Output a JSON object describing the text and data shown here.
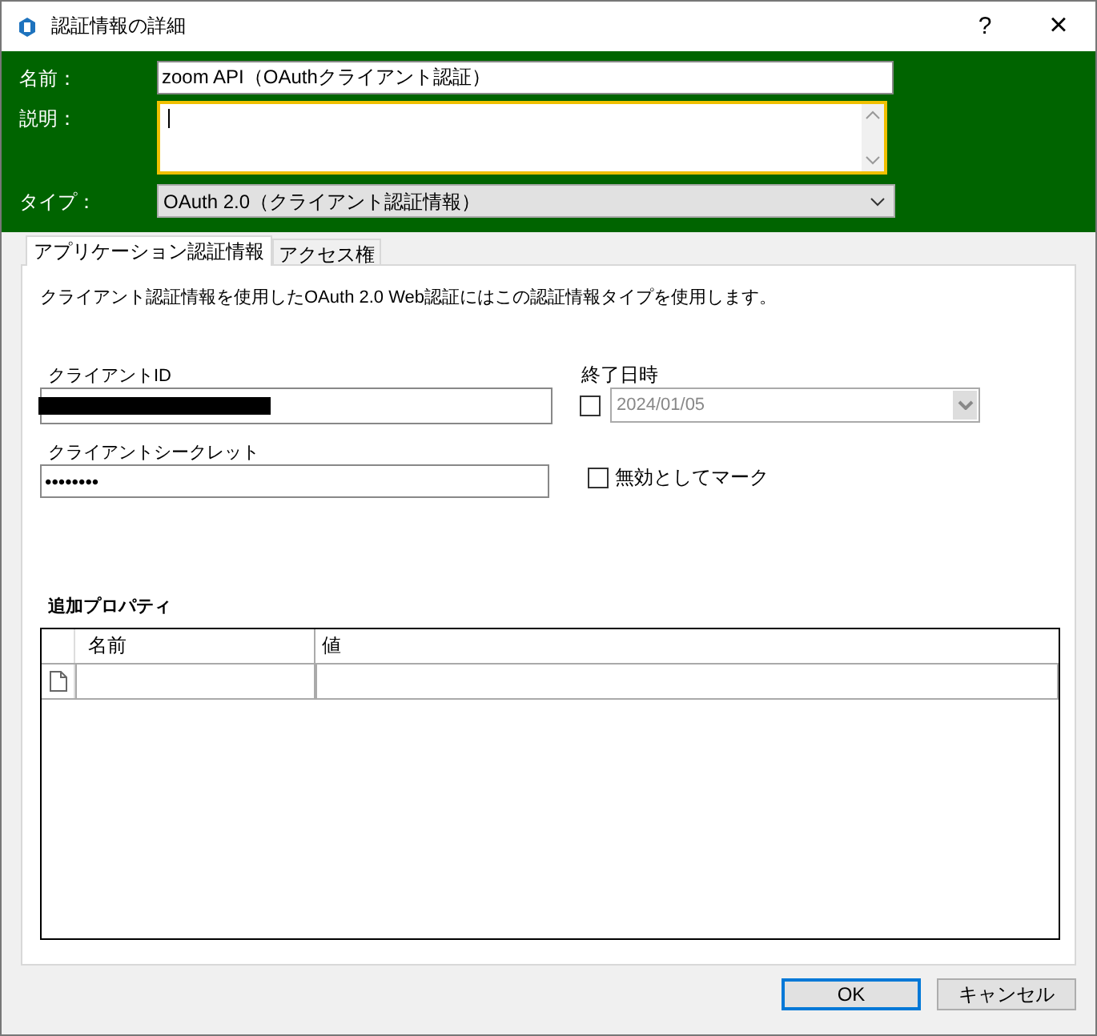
{
  "window": {
    "title": "認証情報の詳細",
    "help": "?",
    "close": "×"
  },
  "fields": [
    {
      "kind": "input",
      "label": "名前：",
      "value": "zoom API（OAuthクライアント認証）",
      "focused": false
    },
    {
      "kind": "textarea",
      "label": "説明：",
      "focused": true
    },
    {
      "kind": "select",
      "label": "タイプ：",
      "value": "OAuth 2.0（クライアント認証情報）",
      "focused": false
    }
  ],
  "tabs": [
    {
      "label": "アプリケーション認証情報",
      "selected": true
    },
    {
      "label": "アクセス権",
      "selected": false
    }
  ],
  "panel": {
    "description": "クライアント認証情報を使用したOAuth 2.0 Web認証にはこの認証情報タイプを使用します。",
    "client_id": {
      "label": "クライアントID",
      "redacted": true
    },
    "end_date": {
      "label": "終了日時",
      "checked": false,
      "value": "2024/01/05",
      "disabled": true
    },
    "client_secret": {
      "label": "クライアントシークレット",
      "value": "••••••••"
    },
    "mark_invalid": {
      "label": "無効としてマーク",
      "checked": false
    }
  },
  "properties": {
    "title": "追加プロパティ",
    "columns": [
      "名前",
      "値"
    ]
  },
  "buttons": [
    {
      "label": "OK",
      "default": true
    },
    {
      "label": "キャンセル",
      "default": false
    }
  ]
}
